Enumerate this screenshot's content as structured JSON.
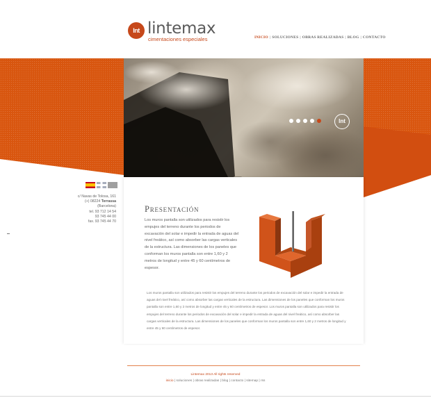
{
  "brand": {
    "mark": "lnt",
    "name": "lintemax",
    "tagline": "cimentaciones especiales"
  },
  "nav": {
    "items": [
      "INICIO",
      "SOLUCIONES",
      "OBRAS REALIZADAS",
      "BLOG",
      "CONTACTO"
    ],
    "active_index": 0,
    "separator": "|"
  },
  "hero": {
    "slides_count": 5,
    "active_slide": 4,
    "badge": "lnt"
  },
  "languages": [
    "es",
    "en",
    "fr"
  ],
  "contact": {
    "address1": "c/ Navas de Tolosa, 161",
    "address2_prefix": "(+) 08224 ",
    "city": "Terrassa",
    "region": "(Barcelona)",
    "tel_line1": "tel. 93 712 14 54",
    "tel_line2": "93 745 44 00",
    "fax": "fax. 93 745 44 70"
  },
  "content": {
    "heading": "Presentación",
    "intro": "Los muros pantalla son utilizados para resistir los empujes del terreno durante los periodos de excavación del solar e impedir la entrada de aguas del nivel freático, así como absorber las cargas verticales de la estructura. Las dimensiones de los paneles que conforman los muros pantalla son entre 1,60 y 2 metros de longitud y entre 45 y 60 centímetros de espesor.",
    "body": "Los muros pantalla son utilizados para resistir los empujes del terreno durante los periodos de excavación del solar e impedir la entrada de aguas del nivel freático, así como absorber las cargas verticales de la estructura. Las dimensiones de los paneles que conforman los muros pantalla son entre 1,60 y 2 metros de longitud y entre 45 y 60 centímetros de espesor. Los muros pantalla son utilizados para resistir los empujes del terreno durante los periodos de excavación del solar e impedir la entrada de aguas del nivel freático, así como absorber las cargas verticales de la estructura. Las dimensiones de los paneles que conforman los muros pantalla son entre 1,60 y 2 metros de longitud y entre 45 y 60 centímetros de espesor."
  },
  "footer": {
    "copyright": "Lintemax 2013 All rights reserved",
    "links": [
      "inicio",
      "soluciones",
      "obras realizadas",
      "blog",
      "contacto",
      "sitemap",
      "rss"
    ],
    "active_index": 0,
    "separator": " | "
  },
  "colors": {
    "accent": "#c6481a",
    "band": "#d9560f",
    "text": "#555555"
  }
}
